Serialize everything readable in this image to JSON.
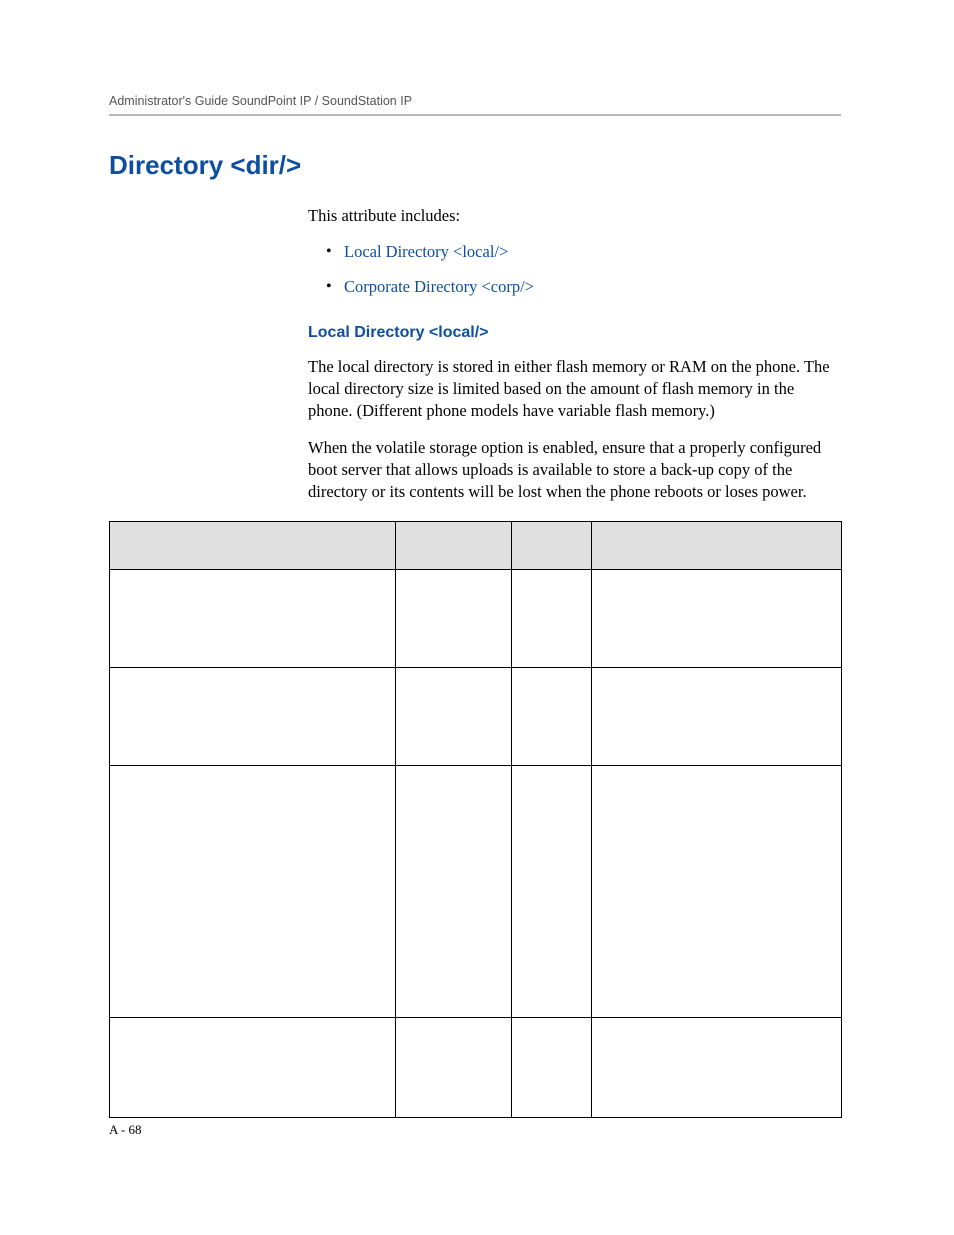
{
  "runningHead": "Administrator's Guide SoundPoint IP / SoundStation IP",
  "heading": "Directory <dir/>",
  "lead": "This attribute includes:",
  "links": {
    "item1": "Local Directory <local/>",
    "item2": "Corporate Directory <corp/>"
  },
  "subheading": "Local Directory <local/>",
  "para1": "The local directory is stored in either flash memory or RAM on the phone. The local directory size is limited based on the amount of flash memory in the phone. (Different phone models have variable flash memory.)",
  "para2": "When the volatile storage option is enabled, ensure that a properly configured boot server that allows uploads is available to store a back-up copy of the directory or its contents will be lost when the phone reboots or loses power.",
  "tableRowHeights": [
    98,
    98,
    252,
    100
  ],
  "pageNumber": "A - 68"
}
